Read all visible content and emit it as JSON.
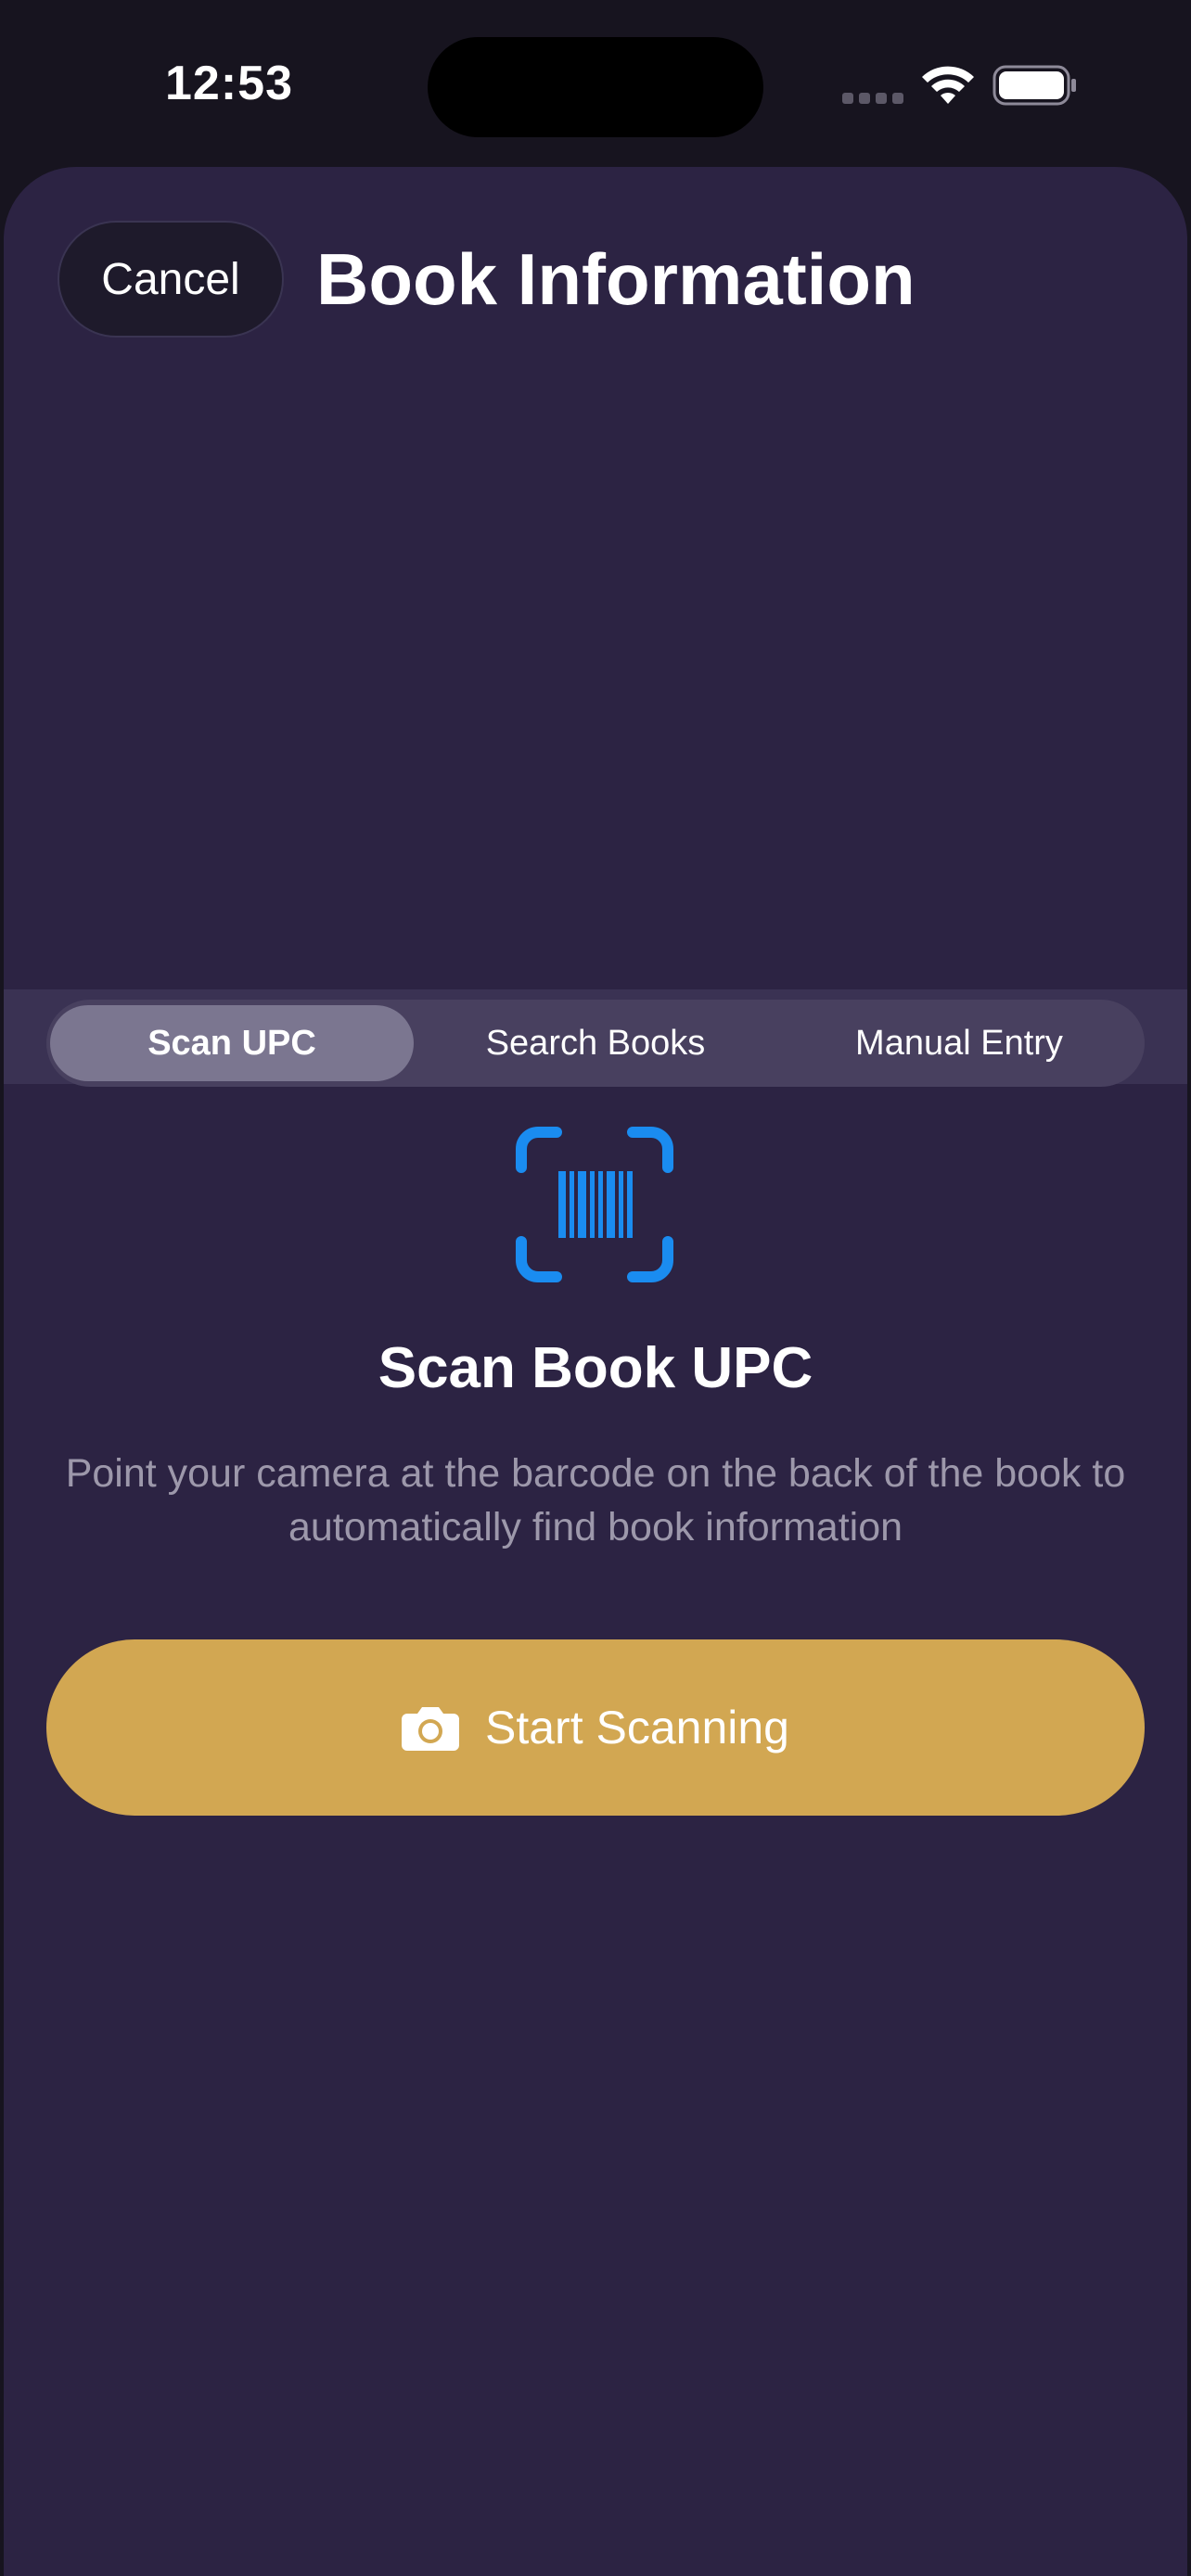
{
  "status_bar": {
    "time": "12:53"
  },
  "header": {
    "cancel_label": "Cancel",
    "title": "Book Information"
  },
  "segmented_control": {
    "tabs": [
      {
        "label": "Scan UPC",
        "selected": true
      },
      {
        "label": "Search Books",
        "selected": false
      },
      {
        "label": "Manual Entry",
        "selected": false
      }
    ]
  },
  "scan": {
    "icon": "barcode-viewfinder-icon",
    "title": "Scan Book UPC",
    "description": "Point your camera at the barcode on the back of the book to automatically find book information",
    "button_icon": "camera-icon",
    "button_label": "Start Scanning"
  },
  "colors": {
    "background": "#2c2343",
    "accent_gold": "#d2a752",
    "icon_blue": "#1a8cf0",
    "selected_segment": "#7b7690"
  }
}
